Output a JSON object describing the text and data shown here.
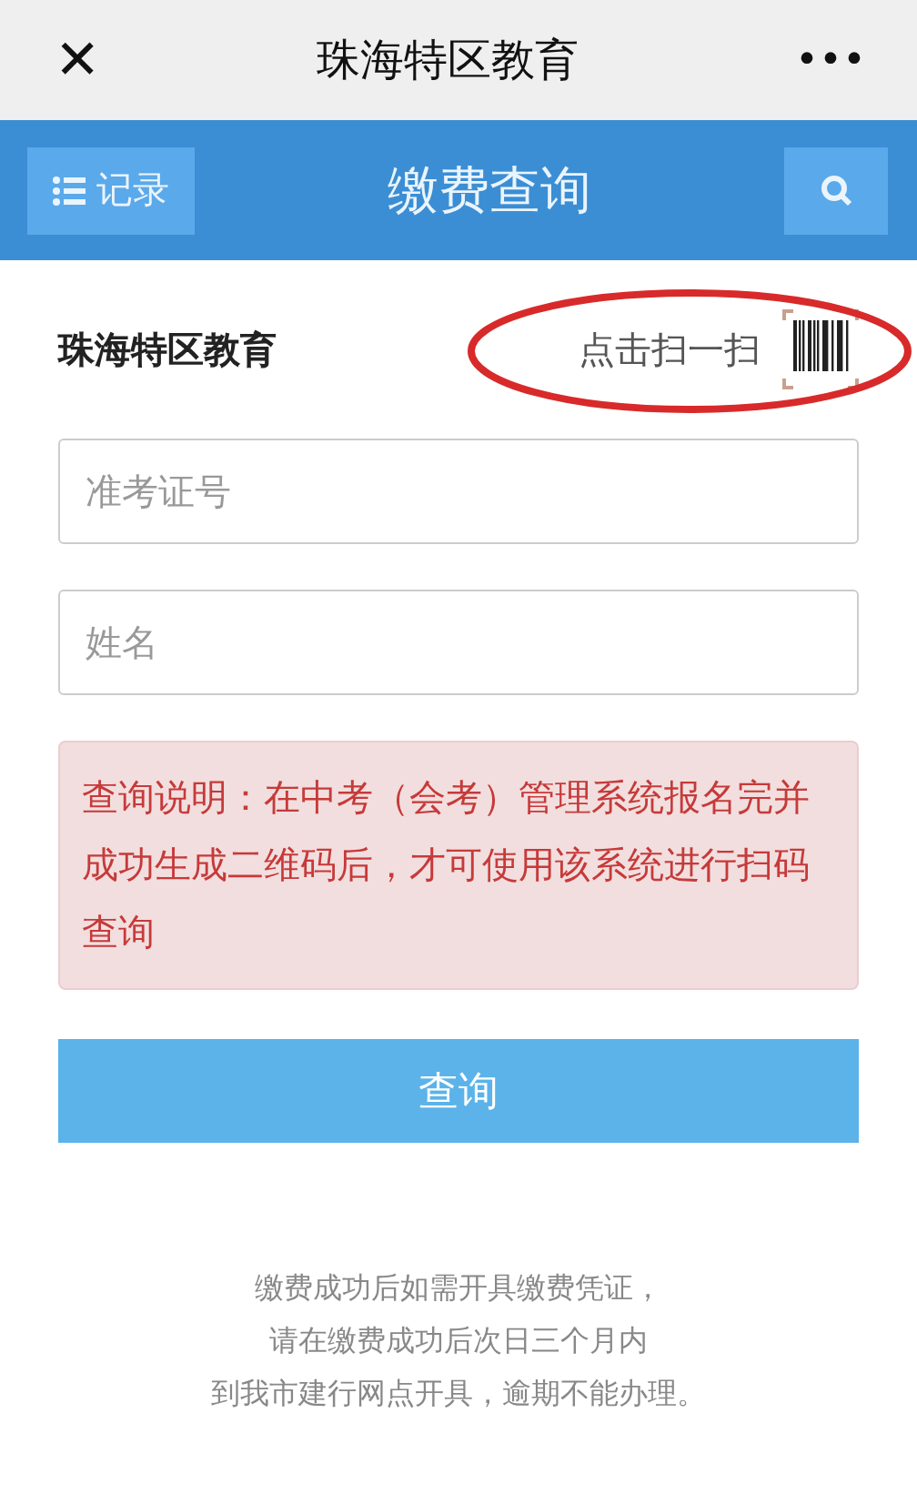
{
  "top_bar": {
    "close": "✕",
    "title": "珠海特区教育",
    "more": "•••"
  },
  "header": {
    "records_button": "记录",
    "title": "缴费查询"
  },
  "org_name": "珠海特区教育",
  "scan_link": "点击扫一扫",
  "fields": [
    {
      "placeholder": "准考证号"
    },
    {
      "placeholder": "姓名"
    }
  ],
  "notice": "查询说明：在中考（会考）管理系统报名完并成功生成二维码后，才可使用该系统进行扫码查询",
  "submit_button": "查询",
  "footer": [
    "缴费成功后如需开具缴费凭证，",
    "请在缴费成功后次日三个月内",
    "到我市建行网点开具，逾期不能办理。"
  ]
}
